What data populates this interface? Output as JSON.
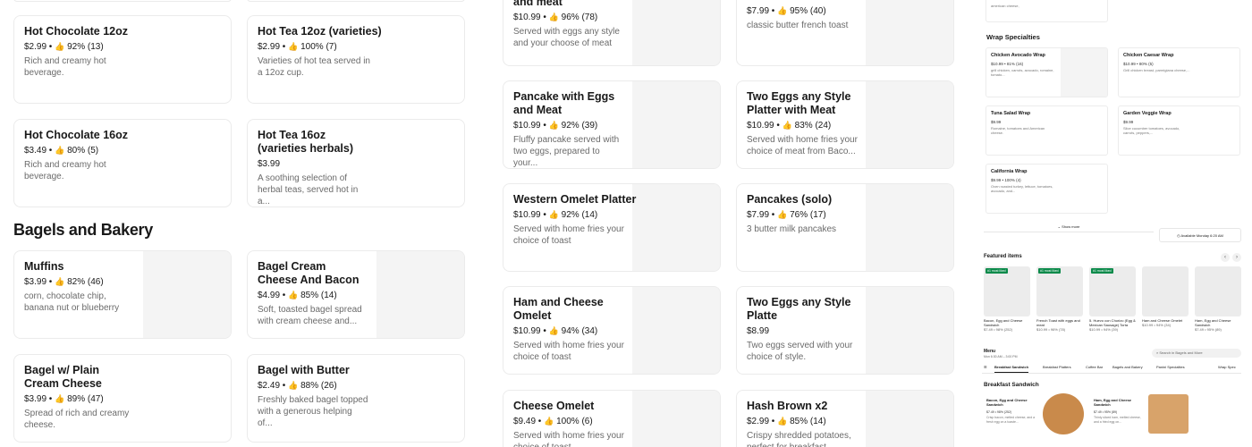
{
  "section": {
    "title": "Bagels and Bakery"
  },
  "cards": [
    {
      "name": "Hot Chocolate 12oz",
      "price": "$2.99",
      "rating": "92% (13)",
      "desc": "Rich and creamy hot beverage."
    },
    {
      "name": "Hot Tea 12oz (varieties)",
      "price": "$2.99",
      "rating": "100% (7)",
      "desc": "Varieties of hot tea served in a 12oz cup."
    },
    {
      "name": "Hot Chocolate 16oz",
      "price": "$3.49",
      "rating": "80% (5)",
      "desc": "Rich and creamy hot beverage."
    },
    {
      "name": "Hot Tea 16oz (varieties herbals)",
      "price": "$3.99",
      "rating": "",
      "desc": "A soothing selection of herbal teas, served hot in a..."
    },
    {
      "name": "Muffins",
      "price": "$3.99",
      "rating": "82% (46)",
      "desc": "corn, chocolate chip, banana nut or blueberry"
    },
    {
      "name": "Bagel Cream Cheese And Bacon",
      "price": "$4.99",
      "rating": "85% (14)",
      "desc": "Soft, toasted bagel spread with cream cheese and..."
    },
    {
      "name": "Bagel w/ Plain Cream Cheese",
      "price": "$3.99",
      "rating": "89% (47)",
      "desc": "Spread of rich and creamy cheese."
    },
    {
      "name": "Bagel with Butter",
      "price": "$2.49",
      "rating": "88% (26)",
      "desc": "Freshly baked bagel topped with a generous helping of..."
    },
    {
      "name": "and meat",
      "price": "$10.99",
      "rating": "96% (78)",
      "desc": "Served with eggs any style and your choose of meat"
    },
    {
      "name": "",
      "price": "$7.99",
      "rating": "95% (40)",
      "desc": "classic butter french toast"
    },
    {
      "name": "Pancake with Eggs and Meat",
      "price": "$10.99",
      "rating": "92% (39)",
      "desc": "Fluffy pancake served with two eggs, prepared to your..."
    },
    {
      "name": "Two Eggs any Style Platter with Meat",
      "price": "$10.99",
      "rating": "83% (24)",
      "desc": "Served with home fries your choice of meat from Baco..."
    },
    {
      "name": "Western Omelet Platter",
      "price": "$10.99",
      "rating": "92% (14)",
      "desc": "Served with home fries your choice of toast"
    },
    {
      "name": "Pancakes (solo)",
      "price": "$7.99",
      "rating": "76% (17)",
      "desc": "3 butter milk pancakes"
    },
    {
      "name": "Ham and Cheese Omelet",
      "price": "$10.99",
      "rating": "94% (34)",
      "desc": "Served with home fries your choice of toast"
    },
    {
      "name": "Two Eggs any Style Platte",
      "price": "$8.99",
      "rating": "",
      "desc": "Two eggs served with your choice of style."
    },
    {
      "name": "Cheese Omelet",
      "price": "$9.49",
      "rating": "100% (6)",
      "desc": "Served with home fries your choice of toast"
    },
    {
      "name": "Hash Brown x2",
      "price": "$2.99",
      "rating": "85% (14)",
      "desc": "Crispy shredded potatoes, perfect for breakfast..."
    }
  ],
  "panel": {
    "top_text": "american cheese,",
    "wrap_title": "Wrap Specialties",
    "wraps": [
      {
        "name": "Chicken Avocado Wrap",
        "meta": "$10.99 • 81% (16)",
        "desc": "grill chicken, carrots, avocado, romaine, tomato..."
      },
      {
        "name": "Chicken Caesar Wrap",
        "meta": "$10.99 • 80% (5)",
        "desc": "Grill chicken breast, parmigiana cheese,..."
      },
      {
        "name": "Tuna Salad Wrap",
        "meta": "$9.99",
        "desc": "Romaine, tomatoes and American cheese."
      },
      {
        "name": "Garden Veggie Wrap",
        "meta": "$9.99",
        "desc": "Slice cucumber tomatoes, avocado, carrots, peppers,..."
      },
      {
        "name": "California Wrap",
        "meta": "$9.99 • 100% (4)",
        "desc": "Oven roasted turkey, lettuce, tomatoes, avocado, and..."
      }
    ],
    "show_more": "Show more",
    "available": "Available Monday 6:20 AM",
    "featured_title": "Featured items",
    "badge": "#1 most liked",
    "featured": [
      {
        "name": "Bacon, Egg and Cheese Sandwich",
        "meta": "$7.49 • 98% (252)"
      },
      {
        "name": "French Toast with eggs and meat",
        "meta": "$10.99 • 96% (78)"
      },
      {
        "name": "5. Huevo con Chorizo (Egg & Mexican Sausage) Torta",
        "meta": "$10.99 • 94% (39)"
      },
      {
        "name": "Ham and Cheese Omelet",
        "meta": "$10.99 • 94% (34)"
      },
      {
        "name": "Ham, Egg and Cheese Sandwich",
        "meta": "$7.49 • 95% (89)"
      }
    ],
    "menu_label": "Menu",
    "menu_hours": "Mon 6:30 AM – 3:00 PM",
    "search_placeholder": "Search in Bagels and More",
    "tabs": [
      "Breakfast Sandwich",
      "Breakfast Platters",
      "Coffee Bar",
      "Bagels and Bakery",
      "Panini Specialties",
      "Wrap Spec"
    ],
    "breakfast_title": "Breakfast Sandwich",
    "sandwiches": [
      {
        "name": "Bacon, Egg and Cheese Sandwich",
        "meta": "$7.49 • 98% (252)",
        "desc": "Crisp bacon, melted cheese, and a fresh egg on a toaste..."
      },
      {
        "name": "Ham, Egg and Cheese Sandwich",
        "meta": "$7.49 • 95% (89)",
        "desc": "Thinly sliced ham, melted cheese, and a fried egg on..."
      }
    ]
  }
}
